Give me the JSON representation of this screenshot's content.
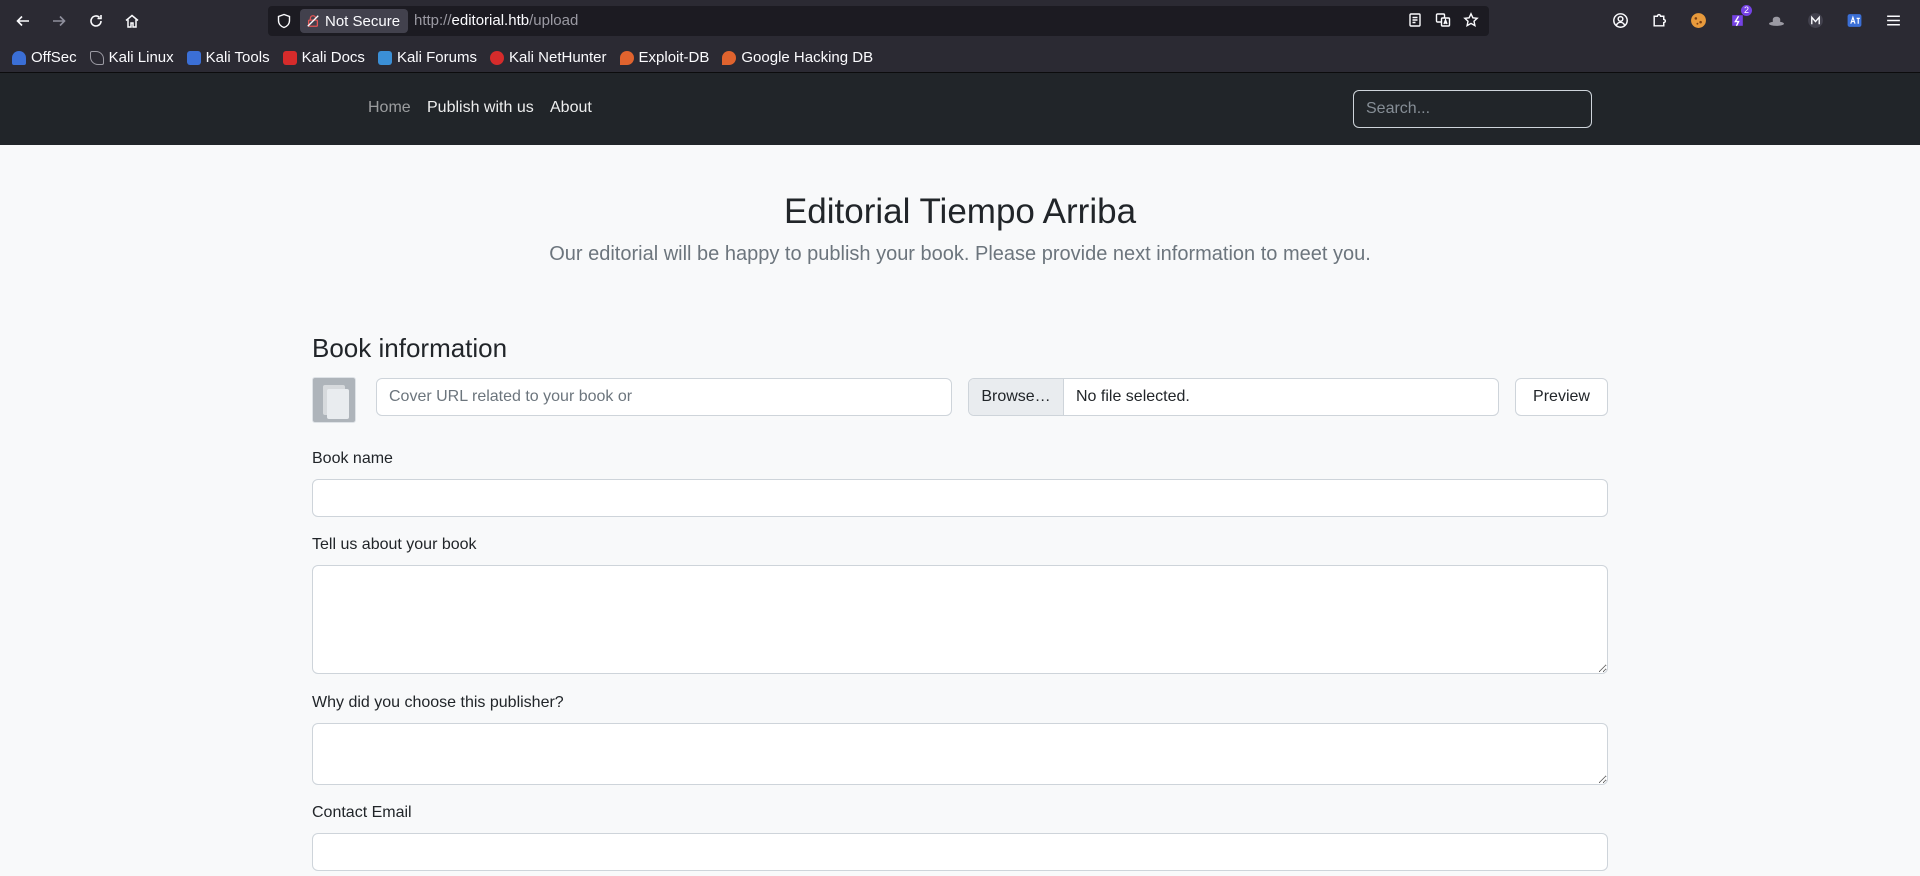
{
  "browser": {
    "security_label": "Not Secure",
    "url_prefix": "http://",
    "url_host": "editorial.htb",
    "url_path": "/upload",
    "extension_badge": "2",
    "bookmarks": [
      {
        "label": "OffSec",
        "color": "#3b6fd6"
      },
      {
        "label": "Kali Linux",
        "color": "#2b2a33"
      },
      {
        "label": "Kali Tools",
        "color": "#3b6fd6"
      },
      {
        "label": "Kali Docs",
        "color": "#d62b2b"
      },
      {
        "label": "Kali Forums",
        "color": "#3b8fd6"
      },
      {
        "label": "Kali NetHunter",
        "color": "#d62b2b"
      },
      {
        "label": "Exploit-DB",
        "color": "#e0632e"
      },
      {
        "label": "Google Hacking DB",
        "color": "#e0632e"
      }
    ]
  },
  "site_nav": {
    "home": "Home",
    "publish": "Publish with us",
    "about": "About",
    "search_placeholder": "Search..."
  },
  "hero": {
    "title": "Editorial Tiempo Arriba",
    "subtitle": "Our editorial will be happy to publish your book. Please provide next information to meet you."
  },
  "form": {
    "section_title": "Book information",
    "cover_url_placeholder": "Cover URL related to your book or",
    "browse_label": "Browse…",
    "file_status": "No file selected.",
    "preview_label": "Preview",
    "book_name_label": "Book name",
    "about_label": "Tell us about your book",
    "why_label": "Why did you choose this publisher?",
    "email_label": "Contact Email"
  }
}
